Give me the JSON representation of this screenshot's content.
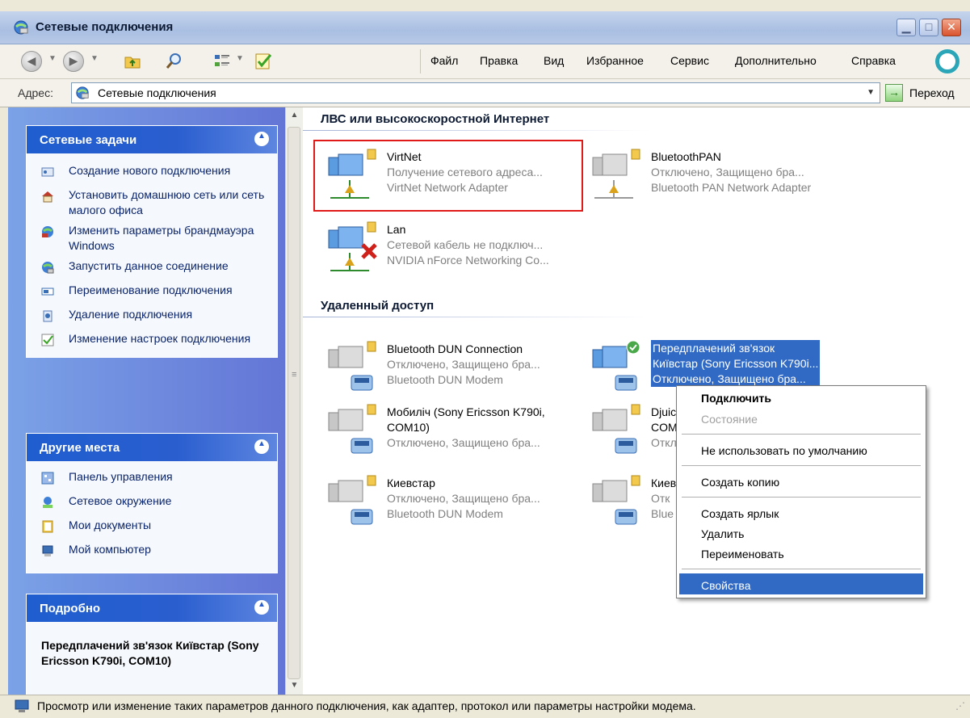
{
  "window": {
    "title": "Сетевые подключения",
    "minimize_label": "▁",
    "maximize_label": "□",
    "close_label": "✕"
  },
  "menu": [
    "Файл",
    "Правка",
    "Вид",
    "Избранное",
    "Сервис",
    "Дополнительно",
    "Справка"
  ],
  "address": {
    "label": "Адрес:",
    "value": "Сетевые подключения",
    "go_label": "Переход"
  },
  "left_panels": {
    "tasks": {
      "title": "Сетевые задачи",
      "items": [
        {
          "label": "Создание нового подключения",
          "icon": "new-connection-icon"
        },
        {
          "label": "Установить домашнюю сеть или сеть малого офиса",
          "icon": "home-network-icon"
        },
        {
          "label": "Изменить параметры брандмауэра Windows",
          "icon": "firewall-icon"
        },
        {
          "label": "Запустить данное соединение",
          "icon": "connect-icon"
        },
        {
          "label": "Переименование подключения",
          "icon": "rename-icon"
        },
        {
          "label": "Удаление подключения",
          "icon": "delete-icon"
        },
        {
          "label": "Изменение настроек подключения",
          "icon": "settings-check-icon"
        }
      ]
    },
    "places": {
      "title": "Другие места",
      "items": [
        {
          "label": "Панель управления",
          "icon": "control-panel-icon"
        },
        {
          "label": "Сетевое окружение",
          "icon": "network-places-icon"
        },
        {
          "label": "Мои документы",
          "icon": "my-documents-icon"
        },
        {
          "label": "Мой компьютер",
          "icon": "my-computer-icon"
        }
      ]
    },
    "details": {
      "title": "Подробно",
      "text": "Передплачений зв'язок Київстар (Sony Ericsson K790i, COM10)"
    }
  },
  "groups": {
    "lan": {
      "title": "ЛВС или высокоскоростной Интернет",
      "items": [
        {
          "name": "VirtNet",
          "status": "Получение сетевого адреса...",
          "device": "VirtNet Network Adapter"
        },
        {
          "name": "BluetoothPAN",
          "status": "Отключено, Защищено бра...",
          "device": "Bluetooth PAN Network Adapter"
        },
        {
          "name": "Lan",
          "status": "Сетевой кабель не подключ...",
          "device": "NVIDIA nForce Networking Co..."
        }
      ]
    },
    "dialup": {
      "title": "Удаленный доступ",
      "items": [
        {
          "name": "Bluetooth DUN Connection",
          "status": "Отключено, Защищено бра...",
          "device": "Bluetooth DUN Modem"
        },
        {
          "name": "Передплачений зв'язок",
          "status": "Київстар (Sony Ericsson K790i...",
          "device": "Отключено, Защищено бра..."
        },
        {
          "name": "Мобиліч (Sony Ericsson K790i,",
          "status": "COM10)",
          "device": "Отключено, Защищено бра..."
        },
        {
          "name": "Djuic",
          "status": "COM",
          "device": "Откл"
        },
        {
          "name": "Киевстар",
          "status": "Отключено, Защищено бра...",
          "device": "Bluetooth DUN Modem"
        },
        {
          "name": "Киев",
          "status": "Отк",
          "device": "Blue"
        }
      ]
    }
  },
  "context_menu": {
    "connect": "Подключить",
    "state": "Состояние",
    "no_default": "Не использовать по умолчанию",
    "copy": "Создать копию",
    "shortcut": "Создать ярлык",
    "delete": "Удалить",
    "rename": "Переименовать",
    "properties": "Свойства"
  },
  "status_bar": "Просмотр или изменение таких параметров данного подключения, как адаптер, протокол или параметры настройки модема.",
  "colors": {
    "selection": "#316ac5",
    "highlight_box": "#e01919",
    "panel_header": "#1f5ecf"
  }
}
